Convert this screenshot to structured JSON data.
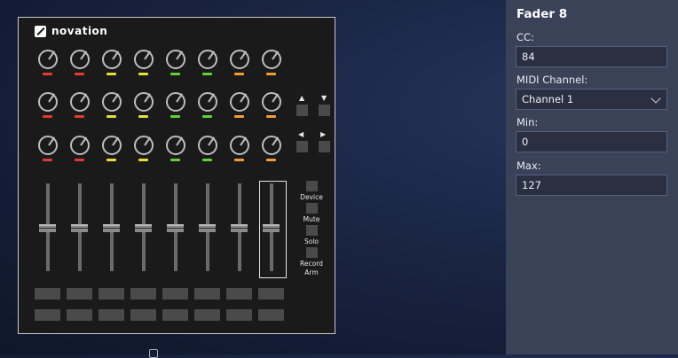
{
  "device": {
    "brand": "novation",
    "knob_rows": [
      [
        "red",
        "red",
        "yellow",
        "yellow",
        "green",
        "green",
        "orange",
        "orange"
      ],
      [
        "red",
        "red",
        "yellow",
        "yellow",
        "green",
        "green",
        "orange",
        "orange"
      ],
      [
        "red",
        "red",
        "yellow",
        "yellow",
        "green",
        "green",
        "orange",
        "orange"
      ]
    ],
    "arrows": {
      "up": "▲",
      "down": "▼",
      "left": "◀",
      "right": "▶"
    },
    "side_buttons": [
      "Device",
      "Mute",
      "Solo",
      "Record Arm"
    ],
    "selected_fader_index": 7
  },
  "panel": {
    "title": "Fader 8",
    "cc_label": "CC:",
    "cc_value": "84",
    "channel_label": "MIDI Channel:",
    "channel_value": "Channel 1",
    "min_label": "Min:",
    "min_value": "0",
    "max_label": "Max:",
    "max_value": "127"
  },
  "colors": {
    "led_red": "#e53b2a",
    "led_yellow": "#e8de3a",
    "led_green": "#5ed336",
    "led_orange": "#f29d38",
    "panel_bg": "#3a4258"
  }
}
